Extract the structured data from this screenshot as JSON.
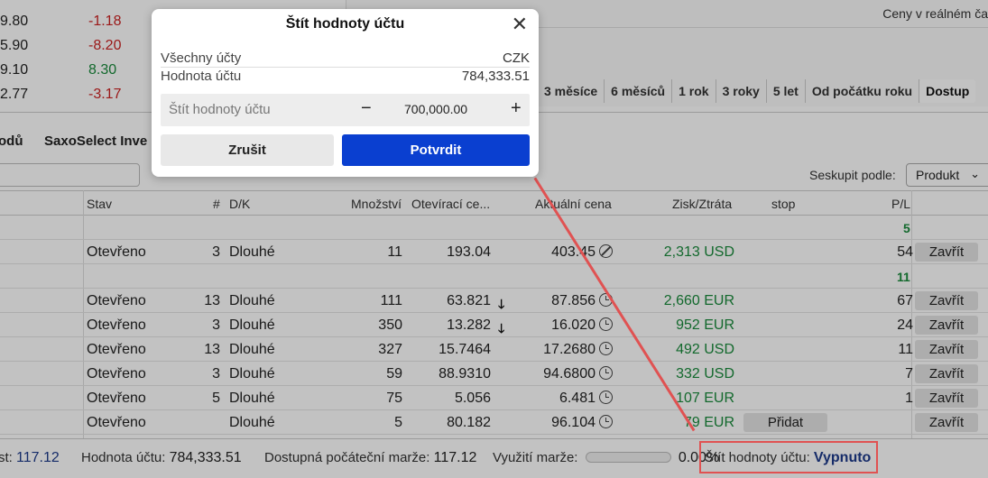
{
  "top_list": [
    {
      "price": "9.80",
      "change": "-1.18",
      "sign": "neg"
    },
    {
      "price": "5.90",
      "change": "-8.20",
      "sign": "neg"
    },
    {
      "price": "9.10",
      "change": "8.30",
      "sign": "pos"
    },
    {
      "price": "2.77",
      "change": "-3.17",
      "sign": "neg"
    }
  ],
  "realtime_note": "Ceny v reálném ča",
  "periods": [
    "3 měsíce",
    "6 měsíců",
    "1 rok",
    "3 roky",
    "5 let",
    "Od počátku roku",
    "Dostup"
  ],
  "tabs": [
    "odů",
    "SaxoSelect Inve"
  ],
  "group_by": {
    "label": "Seskupit podle:",
    "value": "Produkt"
  },
  "columns": {
    "status": "Stav",
    "count": "#",
    "direction": "D/K",
    "quantity": "Množství",
    "open_price": "Otevírací ce...",
    "current_price": "Aktuální cena",
    "pnl": "Zisk/Ztráta",
    "stop": "stop",
    "pl": "P/L"
  },
  "group_totals": [
    "5",
    "11"
  ],
  "rows": [
    {
      "status": "Otevřeno",
      "count": "3",
      "direction": "Dlouhé",
      "quantity": "11",
      "open_price": "193.04",
      "arrow": "",
      "current_price": "403.45",
      "price_icon": "ban",
      "pnl": "2,313 USD",
      "pl": "54",
      "action": "Zavřít"
    },
    {
      "status": "Otevřeno",
      "count": "13",
      "direction": "Dlouhé",
      "quantity": "111",
      "open_price": "63.821",
      "arrow": "🡓",
      "current_price": "87.856",
      "price_icon": "clock",
      "pnl": "2,660 EUR",
      "pl": "67",
      "action": "Zavřít"
    },
    {
      "status": "Otevřeno",
      "count": "3",
      "direction": "Dlouhé",
      "quantity": "350",
      "open_price": "13.282",
      "arrow": "🡓",
      "current_price": "16.020",
      "price_icon": "clock",
      "pnl": "952 EUR",
      "pl": "24",
      "action": "Zavřít"
    },
    {
      "status": "Otevřeno",
      "count": "13",
      "direction": "Dlouhé",
      "quantity": "327",
      "open_price": "15.7464",
      "arrow": "",
      "current_price": "17.2680",
      "price_icon": "clock",
      "pnl": "492 USD",
      "pl": "11",
      "action": "Zavřít"
    },
    {
      "status": "Otevřeno",
      "count": "3",
      "direction": "Dlouhé",
      "quantity": "59",
      "open_price": "88.9310",
      "arrow": "",
      "current_price": "94.6800",
      "price_icon": "clock",
      "pnl": "332 USD",
      "pl": "7",
      "action": "Zavřít"
    },
    {
      "status": "Otevřeno",
      "count": "5",
      "direction": "Dlouhé",
      "quantity": "75",
      "open_price": "5.056",
      "arrow": "",
      "current_price": "6.481",
      "price_icon": "clock",
      "pnl": "107 EUR",
      "pl": "1",
      "action": "Zavřít"
    },
    {
      "status": "Otevřeno",
      "count": "",
      "direction": "Dlouhé",
      "quantity": "5",
      "open_price": "80.182",
      "arrow": "",
      "current_price": "96.104",
      "price_icon": "clock",
      "pnl": "79 EUR",
      "pl": "",
      "action": "Zavřít",
      "stop_action": "Přidat"
    }
  ],
  "footer": {
    "cash_label": "st:",
    "cash_value": "117.12",
    "account_value_label": "Hodnota účtu:",
    "account_value": "784,333.51",
    "available_margin_label": "Dostupná počáteční marže:",
    "available_margin": "117.12",
    "margin_usage_label": "Využití marže:",
    "margin_usage": "0.00%",
    "shield_label": "Štít hodnoty účtu:",
    "shield_status": "Vypnuto"
  },
  "modal": {
    "title": "Štít hodnoty účtu",
    "all_accounts_label": "Všechny účty",
    "currency": "CZK",
    "account_value_label": "Hodnota účtu",
    "account_value": "784,333.51",
    "input_placeholder": "Štít hodnoty účtu",
    "input_value": "700,000.00",
    "minus": "−",
    "plus": "+",
    "cancel_label": "Zrušit",
    "confirm_label": "Potvrdit"
  },
  "colors": {
    "accent": "#0a3fd0",
    "positive": "#1a8a3c",
    "negative": "#cc2222",
    "annotation": "#e05252",
    "status_link": "#1d3a8a"
  }
}
